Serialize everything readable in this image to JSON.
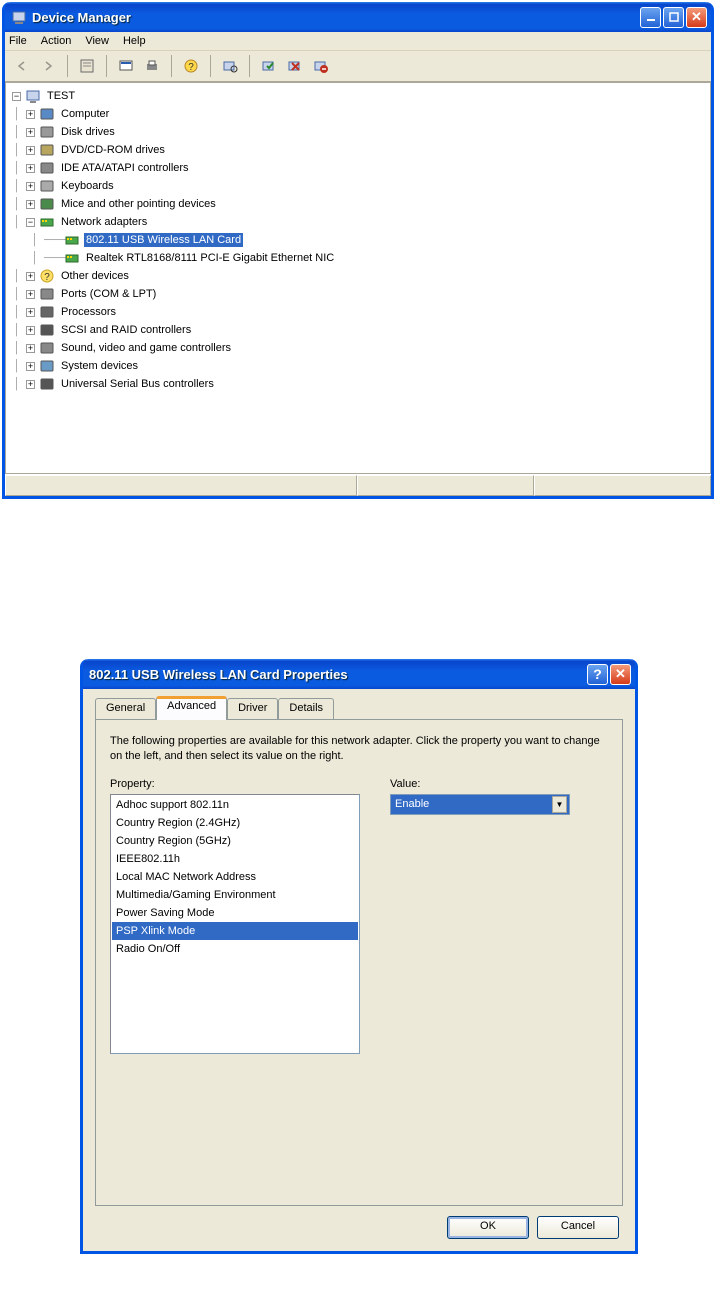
{
  "window1": {
    "title": "Device Manager",
    "menu": [
      "File",
      "Action",
      "View",
      "Help"
    ],
    "tree": {
      "root": "TEST",
      "nodes": [
        {
          "label": "Computer",
          "icon": "computer",
          "exp": "+",
          "depth": 1
        },
        {
          "label": "Disk drives",
          "icon": "disk",
          "exp": "+",
          "depth": 1
        },
        {
          "label": "DVD/CD-ROM drives",
          "icon": "dvd",
          "exp": "+",
          "depth": 1
        },
        {
          "label": "IDE ATA/ATAPI controllers",
          "icon": "ide",
          "exp": "+",
          "depth": 1
        },
        {
          "label": "Keyboards",
          "icon": "keyboard",
          "exp": "+",
          "depth": 1
        },
        {
          "label": "Mice and other pointing devices",
          "icon": "mouse",
          "exp": "+",
          "depth": 1
        },
        {
          "label": "Network adapters",
          "icon": "network",
          "exp": "-",
          "depth": 1
        },
        {
          "label": "802.11 USB Wireless LAN Card",
          "icon": "net-card",
          "exp": "",
          "depth": 2,
          "selected": true
        },
        {
          "label": "Realtek RTL8168/8111 PCI-E Gigabit Ethernet NIC",
          "icon": "net-card",
          "exp": "",
          "depth": 2
        },
        {
          "label": "Other devices",
          "icon": "other",
          "exp": "+",
          "depth": 1
        },
        {
          "label": "Ports (COM & LPT)",
          "icon": "ports",
          "exp": "+",
          "depth": 1
        },
        {
          "label": "Processors",
          "icon": "cpu",
          "exp": "+",
          "depth": 1
        },
        {
          "label": "SCSI and RAID controllers",
          "icon": "scsi",
          "exp": "+",
          "depth": 1
        },
        {
          "label": "Sound, video and game controllers",
          "icon": "sound",
          "exp": "+",
          "depth": 1
        },
        {
          "label": "System devices",
          "icon": "system",
          "exp": "+",
          "depth": 1
        },
        {
          "label": "Universal Serial Bus controllers",
          "icon": "usb",
          "exp": "+",
          "depth": 1
        }
      ]
    }
  },
  "window2": {
    "title": "802.11 USB Wireless LAN Card Properties",
    "tabs": [
      "General",
      "Advanced",
      "Driver",
      "Details"
    ],
    "active_tab": "Advanced",
    "description": "The following properties are available for this network adapter. Click the property you want to change on the left, and then select its value on the right.",
    "property_label": "Property:",
    "value_label": "Value:",
    "properties": [
      "Adhoc support 802.11n",
      "Country Region (2.4GHz)",
      "Country Region (5GHz)",
      "IEEE802.11h",
      "Local MAC Network Address",
      "Multimedia/Gaming Environment",
      "Power Saving Mode",
      "PSP Xlink Mode",
      "Radio On/Off"
    ],
    "selected_property": "PSP Xlink Mode",
    "value": "Enable",
    "ok": "OK",
    "cancel": "Cancel"
  }
}
